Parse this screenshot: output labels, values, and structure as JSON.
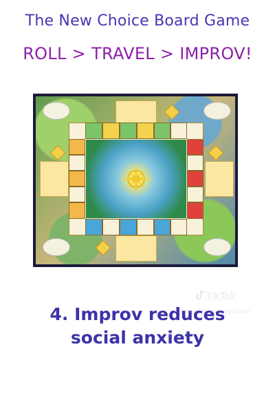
{
  "header": {
    "title": "The New Choice Board Game",
    "subtitle": "ROLL > TRAVEL > IMPROV!"
  },
  "watermark": {
    "brand": "TikTok",
    "handle": "@newchoicemagazine",
    "icon": "tiktok-icon"
  },
  "caption": {
    "line1": "4. Improv reduces",
    "line2": "social anxiety"
  },
  "colors": {
    "title": "#4b34b0",
    "subtitle": "#8e1fa8",
    "caption": "#3c33a8",
    "card_slot": "#fbe7a1"
  }
}
